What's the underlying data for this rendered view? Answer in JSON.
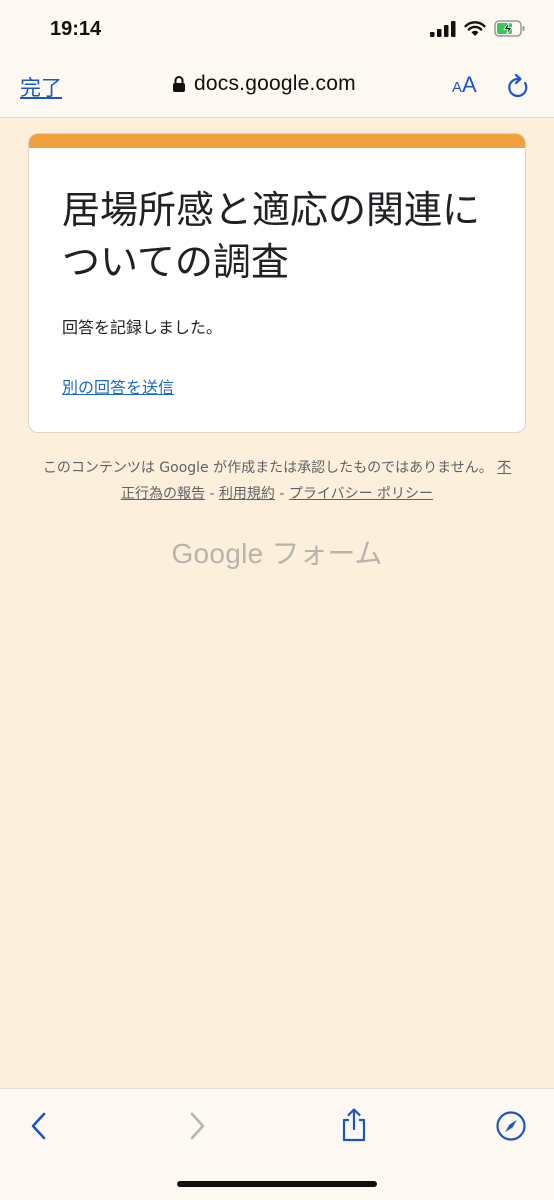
{
  "status_bar": {
    "time": "19:14"
  },
  "browser": {
    "done_label": "完了",
    "url": "docs.google.com",
    "aa_small": "A",
    "aa_big": "A"
  },
  "card": {
    "title": "居場所感と適応の関連についての調査",
    "message": "回答を記録しました。",
    "another_response_link": "別の回答を送信"
  },
  "footer": {
    "disclaimer": "このコンテンツは Google が作成または承認したものではありません。",
    "links": [
      "不正行為の報告",
      "利用規約",
      "プライバシー ポリシー"
    ],
    "separator": " - ",
    "logo_google": "Google",
    "logo_forms": " フォーム"
  },
  "colors": {
    "accent": "#f0a13e",
    "background": "#fcefdc",
    "link": "#1a56c4"
  }
}
